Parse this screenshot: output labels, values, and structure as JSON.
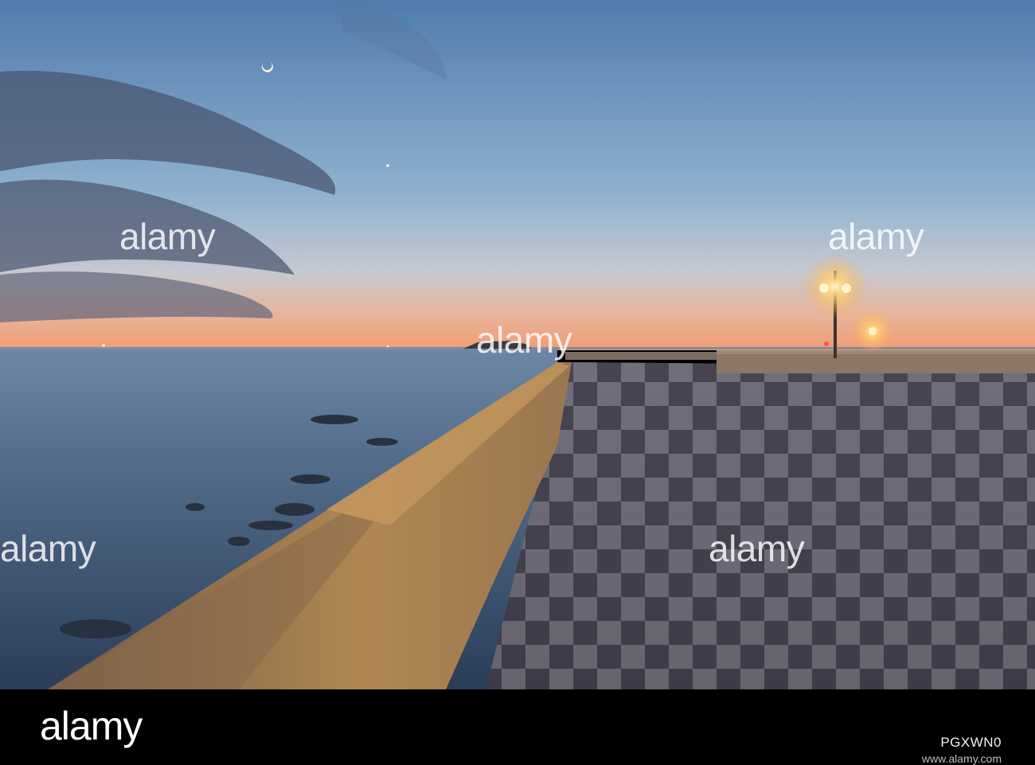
{
  "watermark": {
    "text": "alamy"
  },
  "footer": {
    "brand": "alamy",
    "image_id": "PGXWN0",
    "site": "www.alamy.com"
  },
  "scene": {
    "sky_top": "#5a86b4",
    "sky_horizon": "#f0a278",
    "sea": "#3e5a78",
    "lamp_glow": "#ffd27a",
    "railing": "#a98454"
  }
}
